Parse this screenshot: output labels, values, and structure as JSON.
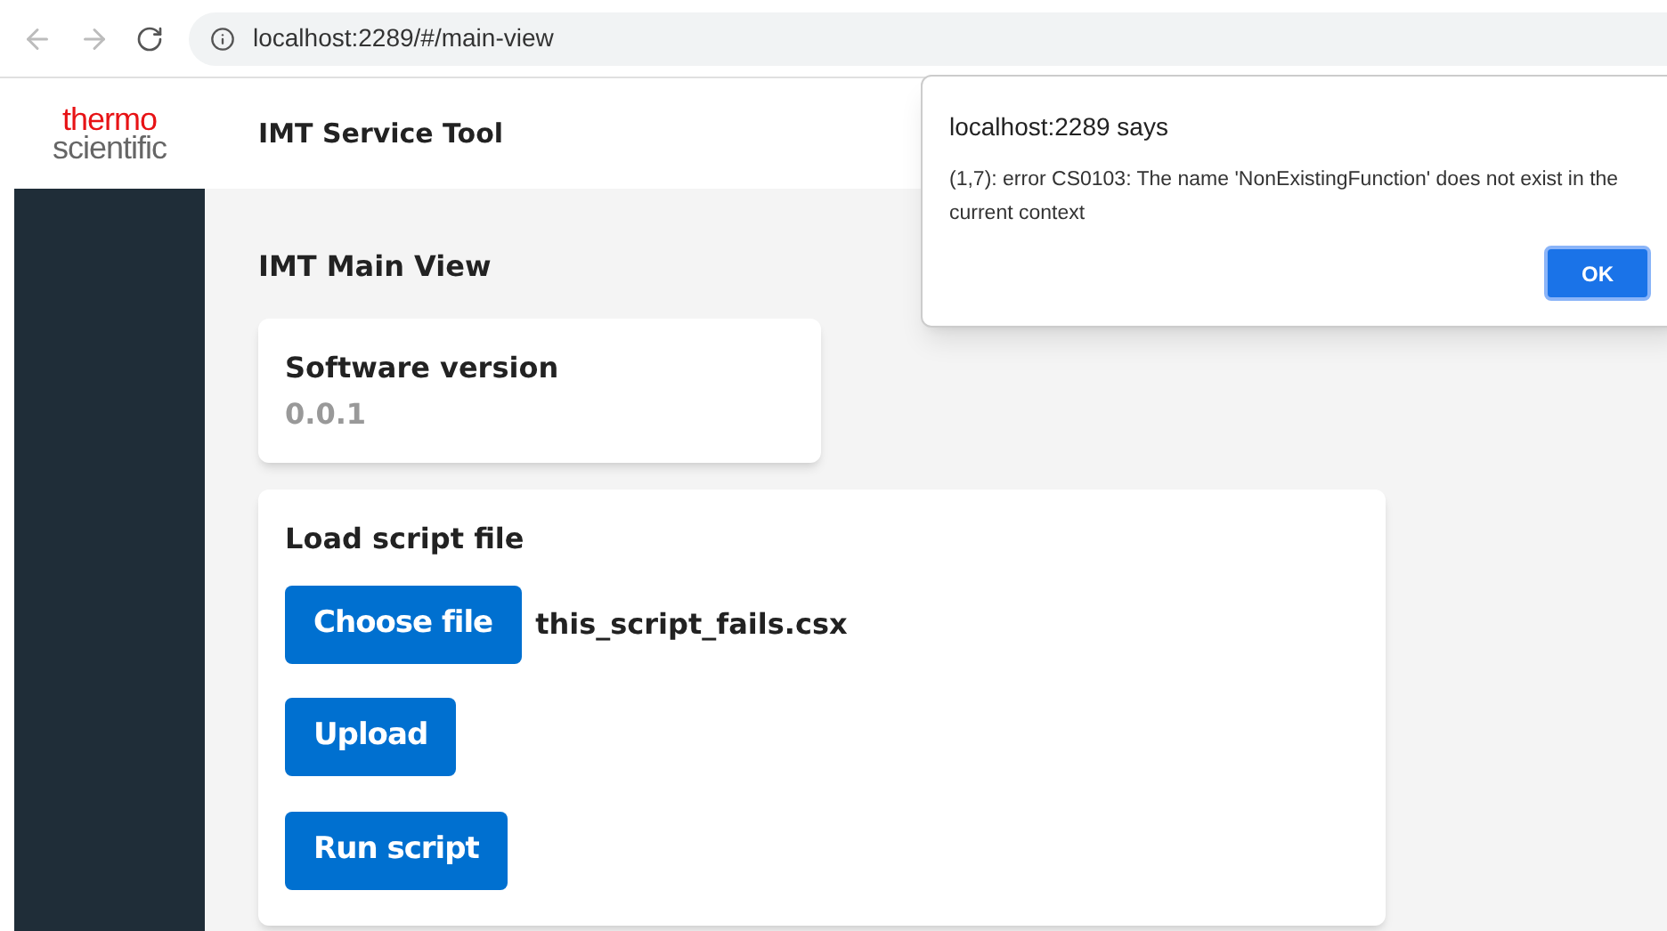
{
  "browser": {
    "url": "localhost:2289/#/main-view"
  },
  "header": {
    "logo_top": "thermo",
    "logo_bottom": "scientific",
    "title": "IMT Service Tool"
  },
  "page": {
    "title": "IMT Main View"
  },
  "version_card": {
    "label": "Software version",
    "value": "0.0.1"
  },
  "script_card": {
    "title": "Load script file",
    "choose_button": "Choose file",
    "file_name": "this_script_fails.csx",
    "upload_button": "Upload",
    "run_button": "Run script"
  },
  "dialog": {
    "title": "localhost:2289 says",
    "message": "(1,7): error CS0103: The name 'NonExistingFunction' does not exist in the current context",
    "ok_button": "OK"
  }
}
